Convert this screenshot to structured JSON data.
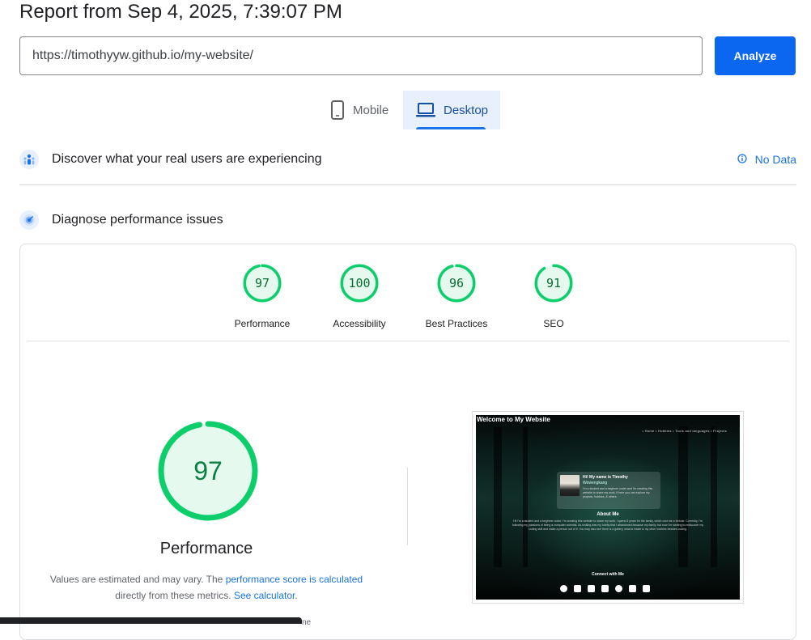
{
  "report": {
    "title": "Report from Sep 4, 2025, 7:39:07 PM"
  },
  "search": {
    "url": "https://timothyyw.github.io/my-website/",
    "analyze_label": "Analyze"
  },
  "tabs": [
    {
      "label": "Mobile",
      "icon": "smartphone-icon",
      "selected": false
    },
    {
      "label": "Desktop",
      "icon": "laptop-icon",
      "selected": true
    }
  ],
  "crux": {
    "title": "Discover what your real users are experiencing",
    "status": "No Data",
    "icon": "users-icon",
    "status_icon": "info-icon"
  },
  "diagnose": {
    "title": "Diagnose performance issues",
    "icon": "speedometer-icon"
  },
  "scores": [
    {
      "label": "Performance",
      "score": 97
    },
    {
      "label": "Accessibility",
      "score": 100
    },
    {
      "label": "Best Practices",
      "score": 96
    },
    {
      "label": "SEO",
      "score": 91
    }
  ],
  "performance": {
    "score": 97,
    "label": "Performance",
    "note_prefix": "Values are estimated and may vary. The",
    "note_link1": "performance score is calculated",
    "note_middle": "directly from these metrics.",
    "note_link2": "See calculator",
    "note_suffix": "."
  },
  "screenshot": {
    "site_title": "Welcome to My Website",
    "nav": "• Home • Hobbies • Tools and languages • Projects",
    "hero_title": "Hi! My name is Timothy",
    "hero_name": "Wewengkang",
    "hero_text": "I'm a student and a beginner coder and I'm creating this website to share my work. If here you can explore my projects, hobbies, & others.",
    "about_title": "About Me",
    "about_text": "Hi! I'm a student and a beginner coder. I'm creating this website to share my work. I spend 8 years for the family, which cost me a fortune. Currently, I'm following my passions of being a computer scientist. As smiling was my hobby that I abandoned because my family, but now I'm starting to rediscover my coding skill and make a person out of it. You may also see there is a gallery, what is inside is my other hobbies besides coding.",
    "connect_title": "Connect with Me"
  },
  "colors": {
    "accent": "#1a73e8",
    "pass": "#0cce6b",
    "pass_bg": "#e6f9ee",
    "pass_text": "#087030"
  },
  "bottom_peek": "ne"
}
